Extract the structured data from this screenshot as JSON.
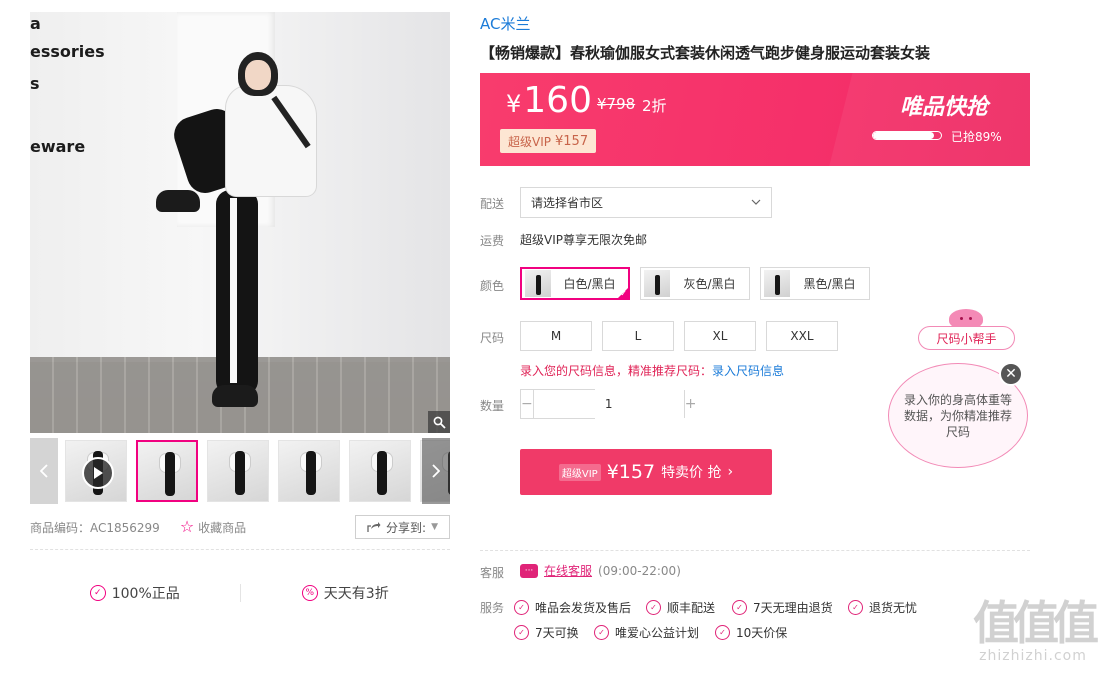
{
  "gallery": {
    "photo_text_lines": [
      "a",
      "essories",
      "s",
      "eware"
    ],
    "thumb_count": 6,
    "selected_thumb": 2
  },
  "product": {
    "code_label": "商品编码：AC1856299",
    "favorite_label": "收藏商品",
    "share_label": "分享到:"
  },
  "promises": [
    {
      "icon": "shield-icon",
      "label": "100%正品"
    },
    {
      "icon": "discount-icon",
      "label": "天天有3折"
    }
  ],
  "header": {
    "brand": "AC米兰",
    "title": "【畅销爆款】春秋瑜伽服女式套装休闲透气跑步健身服运动套装女装"
  },
  "price": {
    "current": "160",
    "currency": "¥",
    "original": "¥798",
    "discount": "2折",
    "vip_prefix": "超级VIP",
    "vip_price": "¥157",
    "flash_title": "唯品快抢",
    "sold_text": "已抢89%",
    "sold_percent": 89
  },
  "fields": {
    "delivery_label": "配送",
    "delivery_select": "请选择省市区",
    "shipping_label": "运费",
    "shipping_text": "超级VIP尊享无限次免邮",
    "color_label": "颜色",
    "colors": [
      "白色/黑白",
      "灰色/黑白",
      "黑色/黑白"
    ],
    "selected_color": 0,
    "size_label": "尺码",
    "sizes": [
      "M",
      "L",
      "XL",
      "XXL"
    ],
    "size_info_prefix": "录入您的尺码信息，精准推荐尺码：",
    "size_info_link": "录入尺码信息",
    "qty_label": "数量",
    "qty_minus": "−",
    "qty_value": "1",
    "qty_plus": "+"
  },
  "buy": {
    "vip_tag": "超级VIP",
    "amount": "¥157",
    "action": "特卖价 抢",
    "arrow": "›"
  },
  "size_helper": {
    "tab_label": "尺码小帮手",
    "bubble_text": "录入你的身高体重等数据，为你精准推荐尺码",
    "close": "✕"
  },
  "service": {
    "label": "客服",
    "chat_icon_text": "···",
    "link": "在线客服",
    "hours": "(09:00-22:00)"
  },
  "guarantees": {
    "label": "服务",
    "items": [
      "唯品会发货及售后",
      "顺丰配送",
      "7天无理由退货",
      "退货无忧",
      "7天可换",
      "唯爱心公益计划",
      "10天价保"
    ]
  },
  "watermark": {
    "big": "值值值",
    "small": "zhizhizhi.com"
  },
  "colors_ref": {
    "accent_pink": "#f10180",
    "price_bg": "#f5306a",
    "link_blue": "#1b7bd8"
  }
}
